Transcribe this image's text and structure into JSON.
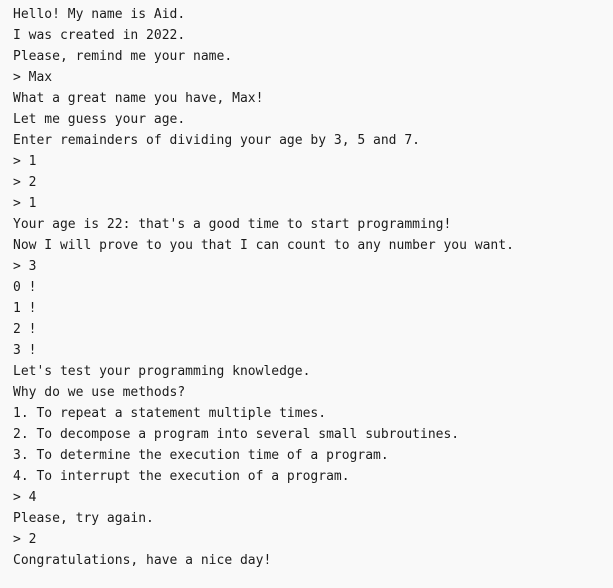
{
  "console": {
    "lines": [
      {
        "kind": "output",
        "text": "Hello! My name is Aid."
      },
      {
        "kind": "output",
        "text": "I was created in 2022."
      },
      {
        "kind": "output",
        "text": "Please, remind me your name."
      },
      {
        "kind": "input",
        "text": "> Max"
      },
      {
        "kind": "output",
        "text": "What a great name you have, Max!"
      },
      {
        "kind": "output",
        "text": "Let me guess your age."
      },
      {
        "kind": "output",
        "text": "Enter remainders of dividing your age by 3, 5 and 7."
      },
      {
        "kind": "input",
        "text": "> 1"
      },
      {
        "kind": "input",
        "text": "> 2"
      },
      {
        "kind": "input",
        "text": "> 1"
      },
      {
        "kind": "output",
        "text": "Your age is 22: that's a good time to start programming!"
      },
      {
        "kind": "output",
        "text": "Now I will prove to you that I can count to any number you want."
      },
      {
        "kind": "input",
        "text": "> 3"
      },
      {
        "kind": "output",
        "text": "0 !"
      },
      {
        "kind": "output",
        "text": "1 !"
      },
      {
        "kind": "output",
        "text": "2 !"
      },
      {
        "kind": "output",
        "text": "3 !"
      },
      {
        "kind": "output",
        "text": "Let's test your programming knowledge."
      },
      {
        "kind": "output",
        "text": "Why do we use methods?"
      },
      {
        "kind": "output",
        "text": "1. To repeat a statement multiple times."
      },
      {
        "kind": "output",
        "text": "2. To decompose a program into several small subroutines."
      },
      {
        "kind": "output",
        "text": "3. To determine the execution time of a program."
      },
      {
        "kind": "output",
        "text": "4. To interrupt the execution of a program."
      },
      {
        "kind": "input",
        "text": "> 4"
      },
      {
        "kind": "output",
        "text": "Please, try again."
      },
      {
        "kind": "input",
        "text": "> 2"
      },
      {
        "kind": "output",
        "text": "Congratulations, have a nice day!"
      }
    ]
  }
}
